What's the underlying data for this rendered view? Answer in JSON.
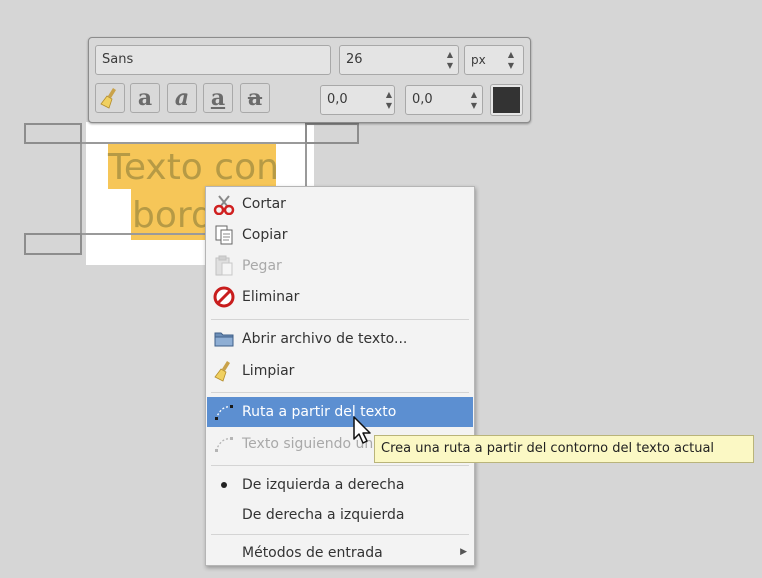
{
  "toolbox": {
    "font_value": "Sans",
    "size_value": "26",
    "unit_value": "px",
    "indent_value": "0,0",
    "spacing_value": "0,0",
    "text_color": "#333333"
  },
  "canvas": {
    "text_line1": "Texto con",
    "text_line2": "borde",
    "highlight_color": "#f5c14a"
  },
  "menu": {
    "items": [
      {
        "label": "Cortar",
        "icon": "scissors-icon",
        "enabled": true
      },
      {
        "label": "Copiar",
        "icon": "copy-icon",
        "enabled": true
      },
      {
        "label": "Pegar",
        "icon": "paste-icon",
        "enabled": false
      },
      {
        "label": "Eliminar",
        "icon": "delete-icon",
        "enabled": true
      },
      {
        "label": "Abrir archivo de texto...",
        "icon": "folder-icon",
        "enabled": true
      },
      {
        "label": "Limpiar",
        "icon": "broom-icon",
        "enabled": true
      },
      {
        "label": "Ruta a partir del texto",
        "icon": "path-icon",
        "enabled": true,
        "highlighted": true
      },
      {
        "label": "Texto siguiendo una ruta",
        "icon": "text-path-icon",
        "enabled": false
      },
      {
        "label": "De izquierda a derecha",
        "icon": "radio-dot-icon",
        "enabled": true,
        "selected": true
      },
      {
        "label": "De derecha a izquierda",
        "enabled": true
      },
      {
        "label": "Métodos de entrada",
        "enabled": true,
        "submenu": true
      }
    ]
  },
  "tooltip": {
    "text": "Crea una ruta a partir del contorno del texto actual"
  },
  "colors": {
    "menu_highlight": "#5c8fd1",
    "tooltip_bg": "#fbf8c4"
  }
}
